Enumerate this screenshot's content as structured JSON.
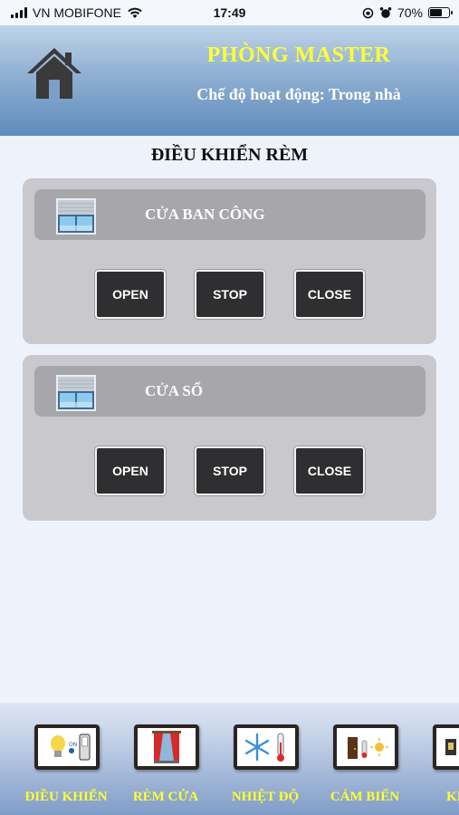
{
  "status_bar": {
    "carrier": "VN MOBIFONE",
    "time": "17:49",
    "battery": "70%",
    "battery_level": 0.7
  },
  "header": {
    "home_icon": "home-icon",
    "room_title": "PHÒNG MASTER",
    "mode_text": "Chế độ hoạt động: Trong nhà"
  },
  "main": {
    "section_title": "ĐIỀU KHIỂN RÈM",
    "panels": [
      {
        "label": "CỬA BAN CÔNG",
        "icon": "window-curtain-icon",
        "buttons": {
          "open": "OPEN",
          "stop": "STOP",
          "close": "CLOSE"
        }
      },
      {
        "label": "CỬA SỔ",
        "icon": "window-curtain-icon",
        "buttons": {
          "open": "OPEN",
          "stop": "STOP",
          "close": "CLOSE"
        }
      }
    ]
  },
  "bottom_nav": {
    "items": [
      {
        "label": "ĐIỀU KHIỂN",
        "icon": "light-switch-icon"
      },
      {
        "label": "RÈM CỬA",
        "icon": "curtain-icon"
      },
      {
        "label": "NHIỆT ĐỘ",
        "icon": "temperature-icon"
      },
      {
        "label": "CẢM BIẾN",
        "icon": "sensor-icon"
      },
      {
        "label": "KỊCH",
        "icon": "scene-icon"
      }
    ]
  },
  "colors": {
    "title_yellow": "#ffff33",
    "header_blue": "#5f8bbb",
    "panel_gray": "#c9c9cd",
    "button_dark": "#2f2f31"
  }
}
